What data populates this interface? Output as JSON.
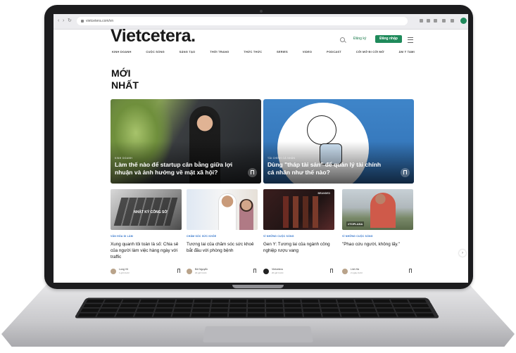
{
  "browser": {
    "url": "vietcetera.com/vn",
    "nav_icons": [
      "back-icon",
      "forward-icon",
      "reload-icon"
    ]
  },
  "site": {
    "logo": "Vietcetera.",
    "login_label": "Đăng ký",
    "signup_label": "Đăng nhập",
    "brand_color": "#1f8a5b"
  },
  "nav": {
    "items": [
      "KINH DOANH",
      "CUỘC SỐNG",
      "SÁNG TẠO",
      "THỜI TRANG",
      "THỨC THỨC",
      "SERIES",
      "VIDEO",
      "PODCAST",
      "CỞI MỞ ĐI CỞI MỞ",
      "ẨM Ý TAMI"
    ]
  },
  "section": {
    "title": "MỚI NHẤT"
  },
  "featured": [
    {
      "category": "KINH DOANH",
      "title": "Làm thế nào để startup cân bằng giữa lợi nhuận và ảnh hưởng về mặt xã hội?"
    },
    {
      "category": "TÀI CHÍNH CÁ NHÂN",
      "title": "Dùng \"tháp tài sản\" để quản lý tài chính cá nhân như thế nào?"
    }
  ],
  "cards": [
    {
      "thumb_text": "NHẬT KÝ CÔNG SỞ",
      "category": "VĂN HÓA DI LÀM",
      "title": "Xung quanh tôi toàn là số: Chia sẻ của người làm việc hàng ngày với traffic",
      "author": "Long Võ",
      "date": "1 giờ trước"
    },
    {
      "thumb_text": "",
      "category": "CHĂM SÓC SỨC KHỎE",
      "title": "Tương lai của chăm sóc sức khoẻ bắt đầu với phòng bệnh",
      "author": "Bối Nguyễn",
      "date": "22 giờ trước"
    },
    {
      "thumb_text": "BRANDED",
      "category": "VÌ NHỮNG CUỘC SỐNG",
      "title": "Gen Y: Tương lai của ngành công nghiệp rượu vang",
      "author": "Vietcetera",
      "date": "20 giờ trước"
    },
    {
      "thumb_text": "#TOPLASA",
      "category": "VÌ NHỮNG CUỘC SỐNG",
      "title": "\"Phao cứu người, không lấy.\"",
      "author": "Linh Hà",
      "date": "2 ngày trước"
    }
  ],
  "accent_colors": {
    "category_blue": "#2a6fc9"
  }
}
